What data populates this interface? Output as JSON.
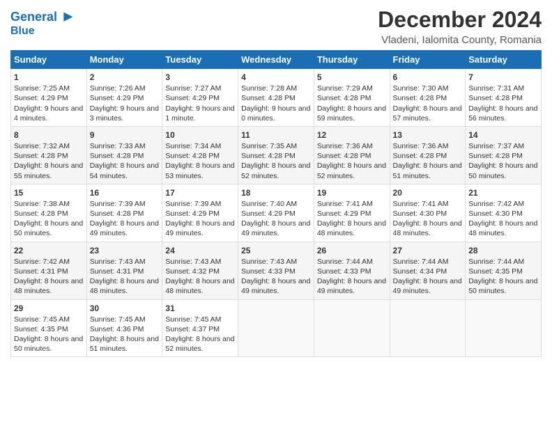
{
  "logo": {
    "line1": "General",
    "line2": "Blue"
  },
  "title": "December 2024",
  "subtitle": "Vladeni, Ialomita County, Romania",
  "days": [
    "Sunday",
    "Monday",
    "Tuesday",
    "Wednesday",
    "Thursday",
    "Friday",
    "Saturday"
  ],
  "weeks": [
    [
      {
        "day": 1,
        "sunrise": "7:25 AM",
        "sunset": "4:29 PM",
        "daylight": "9 hours and 4 minutes."
      },
      {
        "day": 2,
        "sunrise": "7:26 AM",
        "sunset": "4:29 PM",
        "daylight": "9 hours and 3 minutes."
      },
      {
        "day": 3,
        "sunrise": "7:27 AM",
        "sunset": "4:29 PM",
        "daylight": "9 hours and 1 minute."
      },
      {
        "day": 4,
        "sunrise": "7:28 AM",
        "sunset": "4:28 PM",
        "daylight": "9 hours and 0 minutes."
      },
      {
        "day": 5,
        "sunrise": "7:29 AM",
        "sunset": "4:28 PM",
        "daylight": "8 hours and 59 minutes."
      },
      {
        "day": 6,
        "sunrise": "7:30 AM",
        "sunset": "4:28 PM",
        "daylight": "8 hours and 57 minutes."
      },
      {
        "day": 7,
        "sunrise": "7:31 AM",
        "sunset": "4:28 PM",
        "daylight": "8 hours and 56 minutes."
      }
    ],
    [
      {
        "day": 8,
        "sunrise": "7:32 AM",
        "sunset": "4:28 PM",
        "daylight": "8 hours and 55 minutes."
      },
      {
        "day": 9,
        "sunrise": "7:33 AM",
        "sunset": "4:28 PM",
        "daylight": "8 hours and 54 minutes."
      },
      {
        "day": 10,
        "sunrise": "7:34 AM",
        "sunset": "4:28 PM",
        "daylight": "8 hours and 53 minutes."
      },
      {
        "day": 11,
        "sunrise": "7:35 AM",
        "sunset": "4:28 PM",
        "daylight": "8 hours and 52 minutes."
      },
      {
        "day": 12,
        "sunrise": "7:36 AM",
        "sunset": "4:28 PM",
        "daylight": "8 hours and 52 minutes."
      },
      {
        "day": 13,
        "sunrise": "7:36 AM",
        "sunset": "4:28 PM",
        "daylight": "8 hours and 51 minutes."
      },
      {
        "day": 14,
        "sunrise": "7:37 AM",
        "sunset": "4:28 PM",
        "daylight": "8 hours and 50 minutes."
      }
    ],
    [
      {
        "day": 15,
        "sunrise": "7:38 AM",
        "sunset": "4:28 PM",
        "daylight": "8 hours and 50 minutes."
      },
      {
        "day": 16,
        "sunrise": "7:39 AM",
        "sunset": "4:28 PM",
        "daylight": "8 hours and 49 minutes."
      },
      {
        "day": 17,
        "sunrise": "7:39 AM",
        "sunset": "4:29 PM",
        "daylight": "8 hours and 49 minutes."
      },
      {
        "day": 18,
        "sunrise": "7:40 AM",
        "sunset": "4:29 PM",
        "daylight": "8 hours and 49 minutes."
      },
      {
        "day": 19,
        "sunrise": "7:41 AM",
        "sunset": "4:29 PM",
        "daylight": "8 hours and 48 minutes."
      },
      {
        "day": 20,
        "sunrise": "7:41 AM",
        "sunset": "4:30 PM",
        "daylight": "8 hours and 48 minutes."
      },
      {
        "day": 21,
        "sunrise": "7:42 AM",
        "sunset": "4:30 PM",
        "daylight": "8 hours and 48 minutes."
      }
    ],
    [
      {
        "day": 22,
        "sunrise": "7:42 AM",
        "sunset": "4:31 PM",
        "daylight": "8 hours and 48 minutes."
      },
      {
        "day": 23,
        "sunrise": "7:43 AM",
        "sunset": "4:31 PM",
        "daylight": "8 hours and 48 minutes."
      },
      {
        "day": 24,
        "sunrise": "7:43 AM",
        "sunset": "4:32 PM",
        "daylight": "8 hours and 48 minutes."
      },
      {
        "day": 25,
        "sunrise": "7:43 AM",
        "sunset": "4:33 PM",
        "daylight": "8 hours and 49 minutes."
      },
      {
        "day": 26,
        "sunrise": "7:44 AM",
        "sunset": "4:33 PM",
        "daylight": "8 hours and 49 minutes."
      },
      {
        "day": 27,
        "sunrise": "7:44 AM",
        "sunset": "4:34 PM",
        "daylight": "8 hours and 49 minutes."
      },
      {
        "day": 28,
        "sunrise": "7:44 AM",
        "sunset": "4:35 PM",
        "daylight": "8 hours and 50 minutes."
      }
    ],
    [
      {
        "day": 29,
        "sunrise": "7:45 AM",
        "sunset": "4:35 PM",
        "daylight": "8 hours and 50 minutes."
      },
      {
        "day": 30,
        "sunrise": "7:45 AM",
        "sunset": "4:36 PM",
        "daylight": "8 hours and 51 minutes."
      },
      {
        "day": 31,
        "sunrise": "7:45 AM",
        "sunset": "4:37 PM",
        "daylight": "8 hours and 52 minutes."
      },
      null,
      null,
      null,
      null
    ]
  ],
  "labels": {
    "sunrise": "Sunrise:",
    "sunset": "Sunset:",
    "daylight": "Daylight:"
  }
}
